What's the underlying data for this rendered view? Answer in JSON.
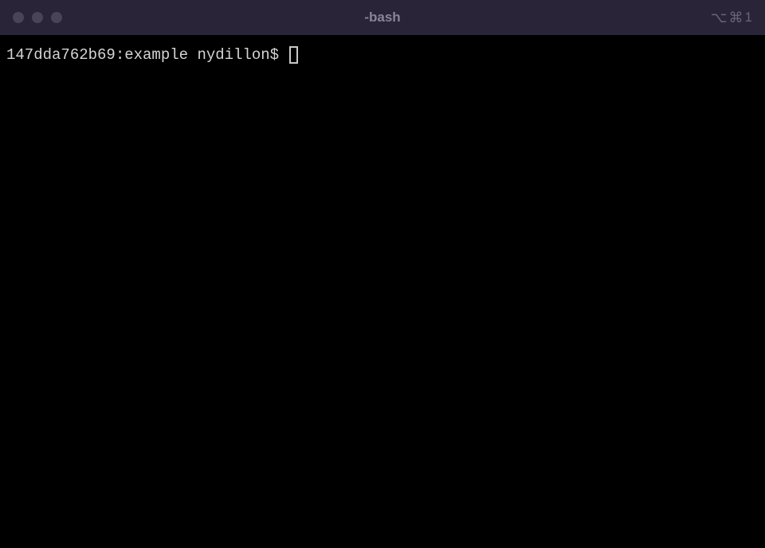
{
  "window": {
    "title": "-bash",
    "shortcut": {
      "option": "⌥",
      "cmd": "⌘",
      "num": "1"
    }
  },
  "terminal": {
    "prompt": "147dda762b69:example nydillon$ "
  }
}
